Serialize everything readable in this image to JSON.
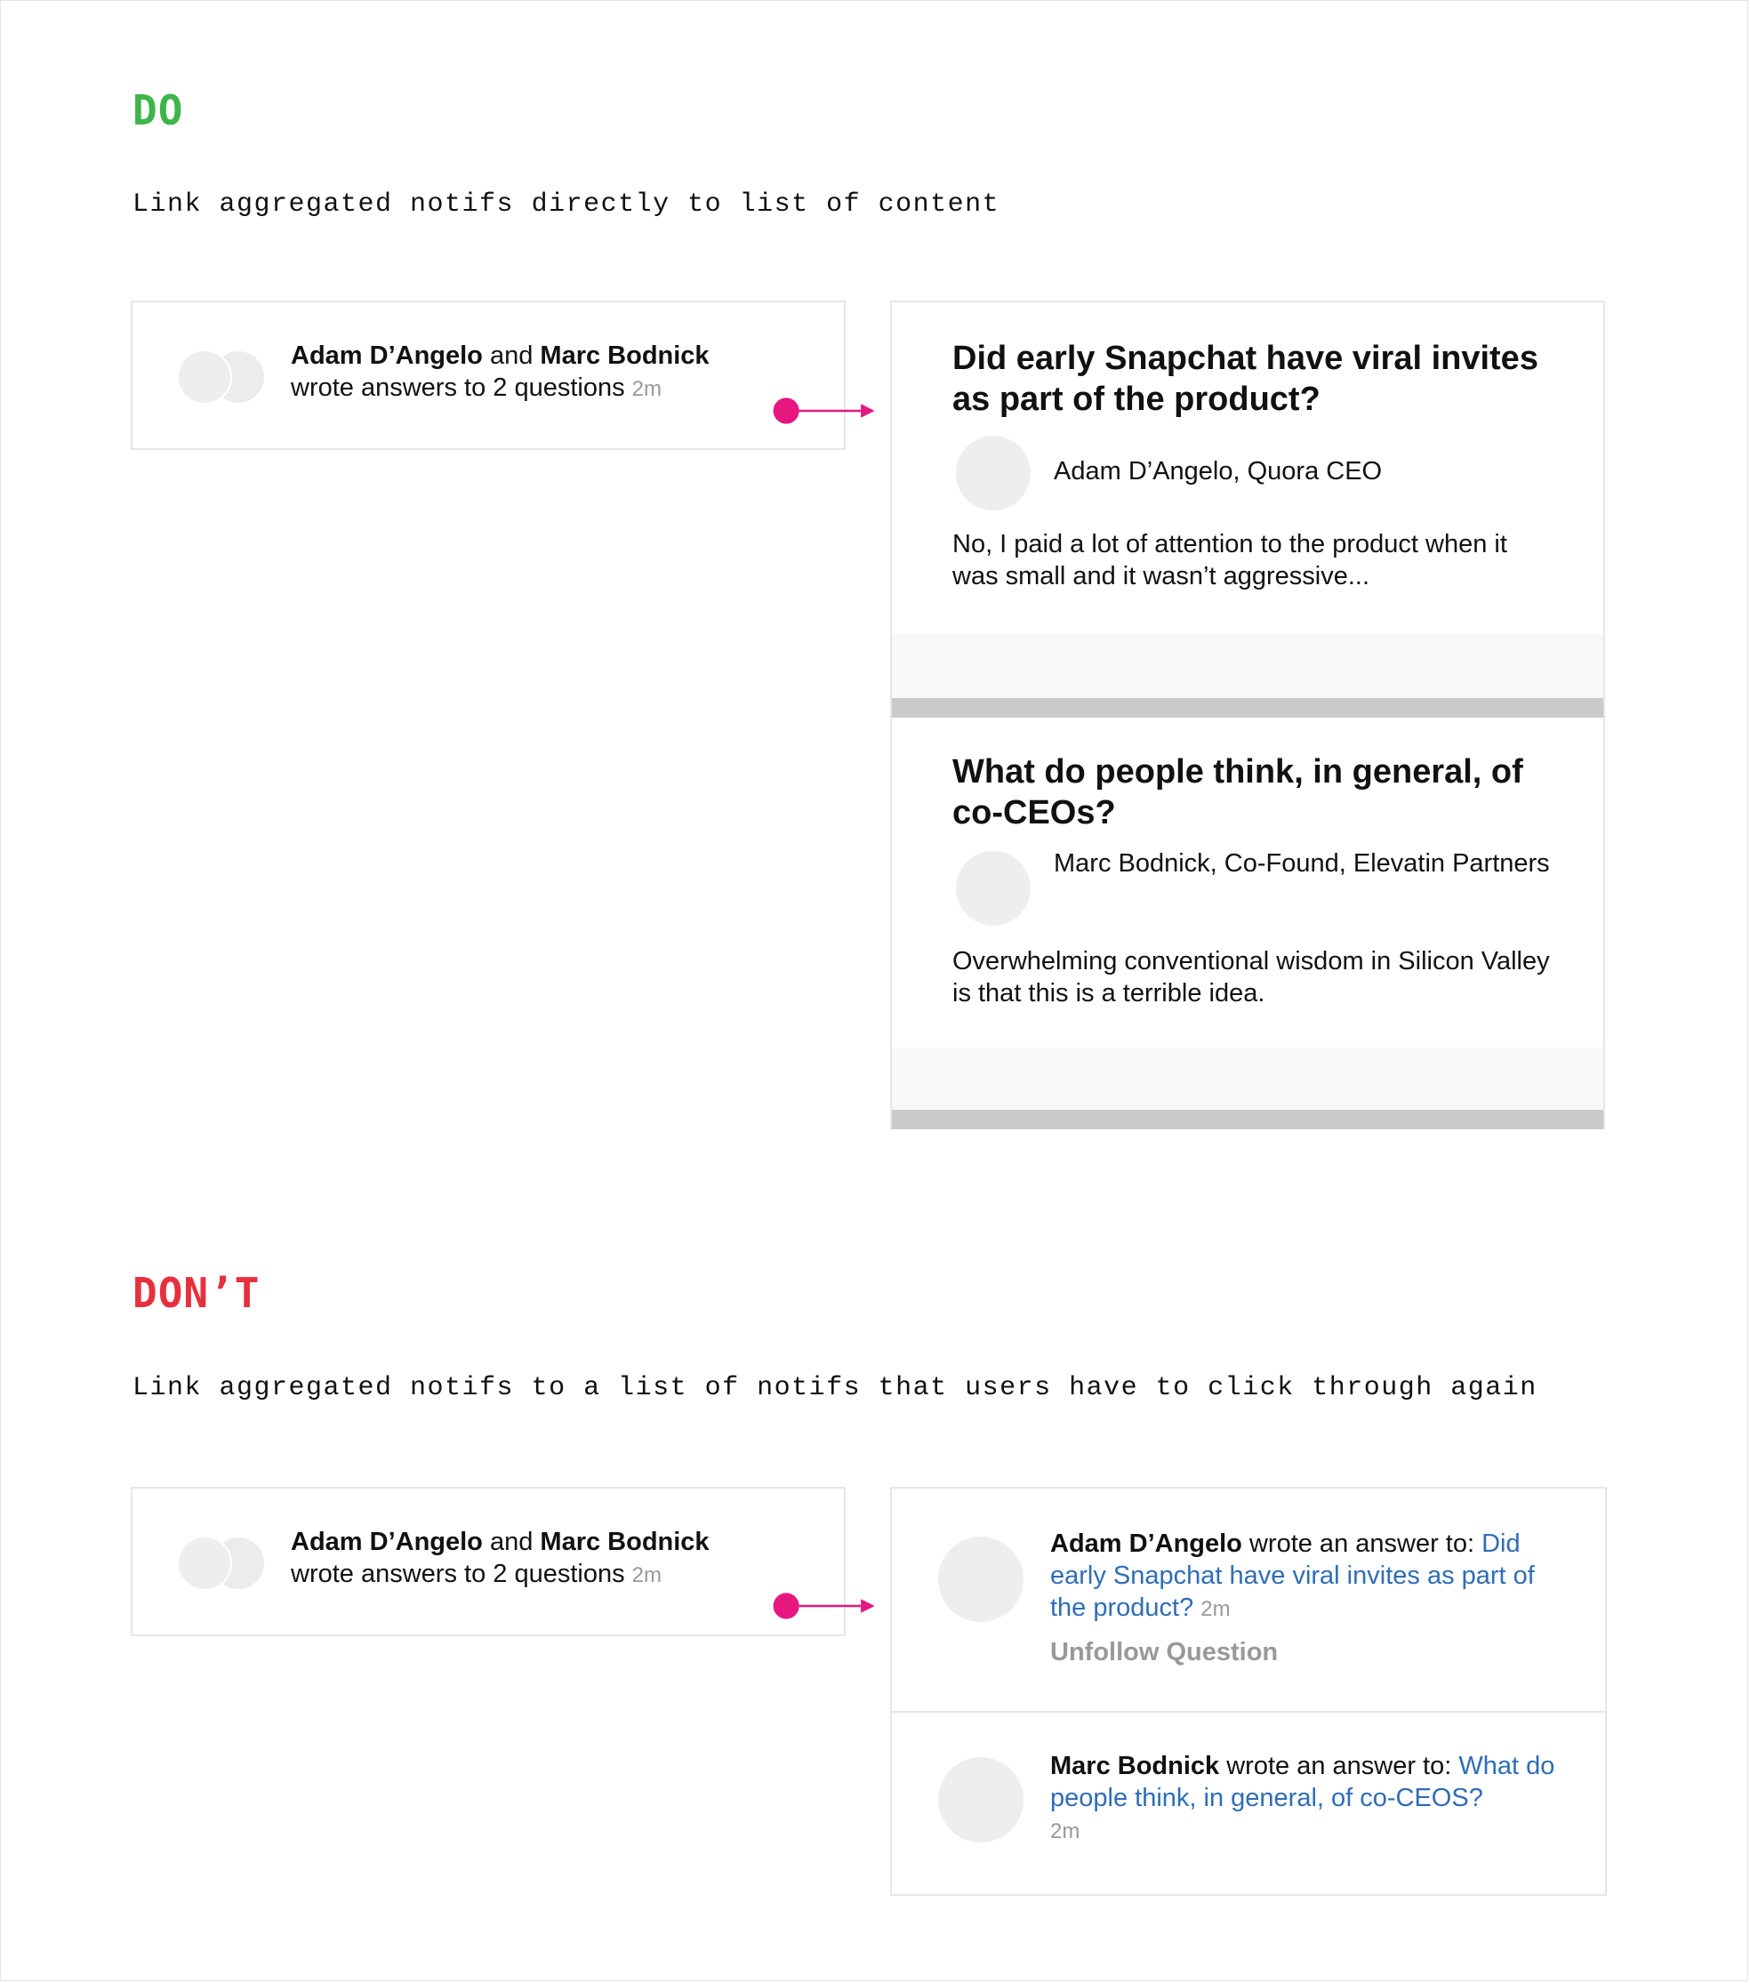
{
  "do_section": {
    "heading": "DO",
    "caption": "Link aggregated notifs directly to list of content",
    "notification": {
      "user1": "Adam D’Angelo",
      "joiner": " and ",
      "user2": "Marc Bodnick",
      "action": "wrote answers to 2 questions",
      "time": "2m"
    },
    "questions": [
      {
        "title": "Did early Snapchat have viral invites as part of the product?",
        "author": "Adam D’Angelo, Quora CEO",
        "excerpt": "No, I paid a lot of attention to the product when it was small and it wasn’t aggressive..."
      },
      {
        "title": "What do people think, in general, of co-CEOs?",
        "author": "Marc Bodnick, Co-Found, Elevatin Partners",
        "excerpt": "Overwhelming conventional wisdom in Silicon Valley is that this is a terrible idea."
      }
    ]
  },
  "dont_section": {
    "heading": "DON’T",
    "caption": "Link aggregated notifs to a list of notifs that users have to click through again",
    "notification": {
      "user1": "Adam D’Angelo",
      "joiner": " and ",
      "user2": "Marc Bodnick",
      "action": "wrote answers to 2 questions",
      "time": "2m"
    },
    "list": [
      {
        "user": "Adam D’Angelo",
        "action": " wrote an answer to: ",
        "question": "Did early Snapchat have viral invites as part of the product?",
        "time": "2m",
        "secondary_action": "Unfollow Question"
      },
      {
        "user": "Marc Bodnick",
        "action": " wrote an answer to: ",
        "question": "What do people think, in general, of co-CEOS?",
        "time": "2m"
      }
    ]
  },
  "colors": {
    "do": "#3db54a",
    "dont": "#e8303c",
    "connector": "#e6177f",
    "link": "#2f6db6"
  }
}
